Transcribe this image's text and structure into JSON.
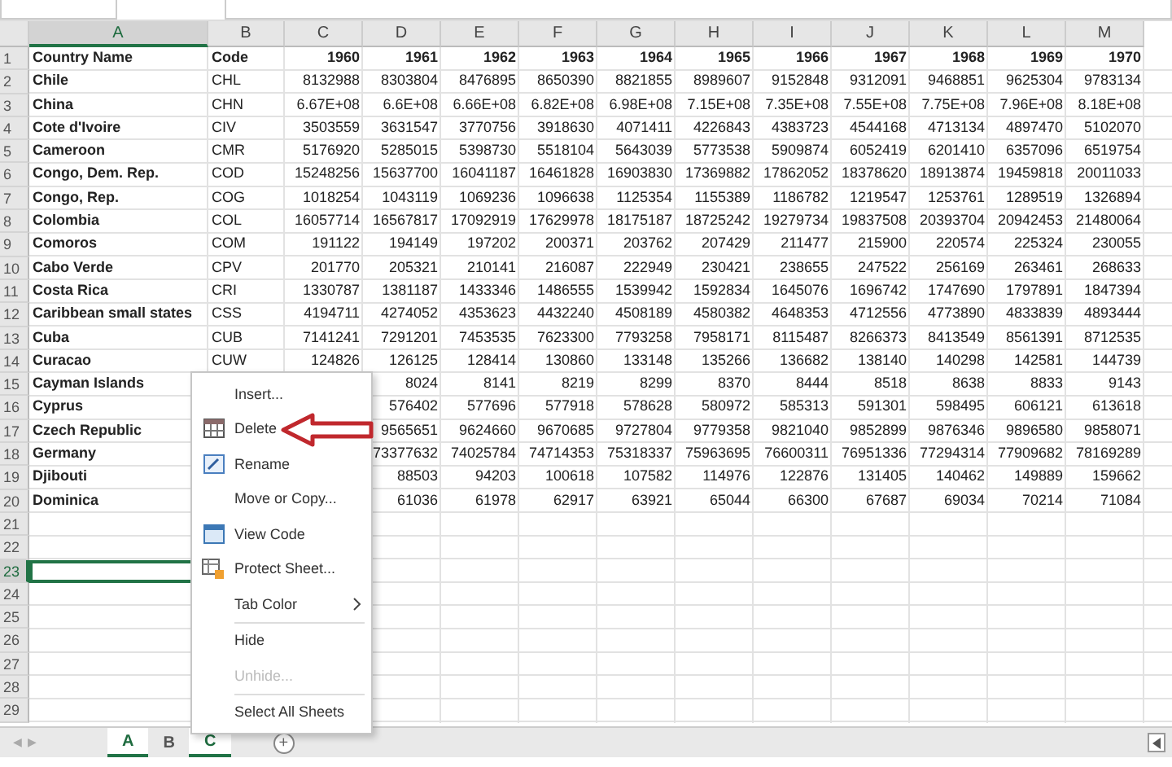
{
  "columns": [
    "A",
    "B",
    "C",
    "D",
    "E",
    "F",
    "G",
    "H",
    "I",
    "J",
    "K",
    "L",
    "M"
  ],
  "header_row": {
    "name": "Country Name",
    "code": "Code",
    "years": [
      "1960",
      "1961",
      "1962",
      "1963",
      "1964",
      "1965",
      "1966",
      "1967",
      "1968",
      "1969",
      "1970"
    ]
  },
  "rows": [
    {
      "name": "Chile",
      "code": "CHL",
      "values": [
        "8132988",
        "8303804",
        "8476895",
        "8650390",
        "8821855",
        "8989607",
        "9152848",
        "9312091",
        "9468851",
        "9625304",
        "9783134"
      ]
    },
    {
      "name": "China",
      "code": "CHN",
      "values": [
        "6.67E+08",
        "6.6E+08",
        "6.66E+08",
        "6.82E+08",
        "6.98E+08",
        "7.15E+08",
        "7.35E+08",
        "7.55E+08",
        "7.75E+08",
        "7.96E+08",
        "8.18E+08"
      ]
    },
    {
      "name": "Cote d'Ivoire",
      "code": "CIV",
      "values": [
        "3503559",
        "3631547",
        "3770756",
        "3918630",
        "4071411",
        "4226843",
        "4383723",
        "4544168",
        "4713134",
        "4897470",
        "5102070"
      ]
    },
    {
      "name": "Cameroon",
      "code": "CMR",
      "values": [
        "5176920",
        "5285015",
        "5398730",
        "5518104",
        "5643039",
        "5773538",
        "5909874",
        "6052419",
        "6201410",
        "6357096",
        "6519754"
      ]
    },
    {
      "name": "Congo, Dem. Rep.",
      "code": "COD",
      "values": [
        "15248256",
        "15637700",
        "16041187",
        "16461828",
        "16903830",
        "17369882",
        "17862052",
        "18378620",
        "18913874",
        "19459818",
        "20011033"
      ]
    },
    {
      "name": "Congo, Rep.",
      "code": "COG",
      "values": [
        "1018254",
        "1043119",
        "1069236",
        "1096638",
        "1125354",
        "1155389",
        "1186782",
        "1219547",
        "1253761",
        "1289519",
        "1326894"
      ]
    },
    {
      "name": "Colombia",
      "code": "COL",
      "values": [
        "16057714",
        "16567817",
        "17092919",
        "17629978",
        "18175187",
        "18725242",
        "19279734",
        "19837508",
        "20393704",
        "20942453",
        "21480064"
      ]
    },
    {
      "name": "Comoros",
      "code": "COM",
      "values": [
        "191122",
        "194149",
        "197202",
        "200371",
        "203762",
        "207429",
        "211477",
        "215900",
        "220574",
        "225324",
        "230055"
      ]
    },
    {
      "name": "Cabo Verde",
      "code": "CPV",
      "values": [
        "201770",
        "205321",
        "210141",
        "216087",
        "222949",
        "230421",
        "238655",
        "247522",
        "256169",
        "263461",
        "268633"
      ]
    },
    {
      "name": "Costa Rica",
      "code": "CRI",
      "values": [
        "1330787",
        "1381187",
        "1433346",
        "1486555",
        "1539942",
        "1592834",
        "1645076",
        "1696742",
        "1747690",
        "1797891",
        "1847394"
      ]
    },
    {
      "name": "Caribbean small states",
      "code": "CSS",
      "values": [
        "4194711",
        "4274052",
        "4353623",
        "4432240",
        "4508189",
        "4580382",
        "4648353",
        "4712556",
        "4773890",
        "4833839",
        "4893444"
      ]
    },
    {
      "name": "Cuba",
      "code": "CUB",
      "values": [
        "7141241",
        "7291201",
        "7453535",
        "7623300",
        "7793258",
        "7958171",
        "8115487",
        "8266373",
        "8413549",
        "8561391",
        "8712535"
      ]
    },
    {
      "name": "Curacao",
      "code": "CUW",
      "values": [
        "124826",
        "126125",
        "128414",
        "130860",
        "133148",
        "135266",
        "136682",
        "138140",
        "140298",
        "142581",
        "144739"
      ]
    },
    {
      "name": "Cayman Islands",
      "values": [
        "8024",
        "8141",
        "8219",
        "8299",
        "8370",
        "8444",
        "8518",
        "8638",
        "8833",
        "9143"
      ]
    },
    {
      "name": "Cyprus",
      "values": [
        "576402",
        "577696",
        "577918",
        "578628",
        "580972",
        "585313",
        "591301",
        "598495",
        "606121",
        "613618"
      ]
    },
    {
      "name": "Czech Republic",
      "values": [
        "9565651",
        "9624660",
        "9670685",
        "9727804",
        "9779358",
        "9821040",
        "9852899",
        "9876346",
        "9896580",
        "9858071"
      ]
    },
    {
      "name": "Germany",
      "values": [
        "73377632",
        "74025784",
        "74714353",
        "75318337",
        "75963695",
        "76600311",
        "76951336",
        "77294314",
        "77909682",
        "78169289"
      ]
    },
    {
      "name": "Djibouti",
      "values": [
        "88503",
        "94203",
        "100618",
        "107582",
        "114976",
        "122876",
        "131405",
        "140462",
        "149889",
        "159662"
      ]
    },
    {
      "name": "Dominica",
      "values": [
        "61036",
        "61978",
        "62917",
        "63921",
        "65044",
        "66300",
        "67687",
        "69034",
        "70214",
        "71084"
      ]
    }
  ],
  "row_numbers": [
    {
      "label": "1",
      "selected": false
    },
    {
      "label": "2",
      "selected": false
    },
    {
      "label": "3",
      "selected": false
    },
    {
      "label": "4",
      "selected": false
    },
    {
      "label": "5",
      "selected": false
    },
    {
      "label": "6",
      "selected": false
    },
    {
      "label": "7",
      "selected": false
    },
    {
      "label": "8",
      "selected": false
    },
    {
      "label": "9",
      "selected": false
    },
    {
      "label": "10",
      "selected": false
    },
    {
      "label": "11",
      "selected": false
    },
    {
      "label": "12",
      "selected": false
    },
    {
      "label": "13",
      "selected": false
    },
    {
      "label": "14",
      "selected": false
    },
    {
      "label": "15",
      "selected": false
    },
    {
      "label": "16",
      "selected": false
    },
    {
      "label": "17",
      "selected": false
    },
    {
      "label": "18",
      "selected": false
    },
    {
      "label": "19",
      "selected": false
    },
    {
      "label": "20",
      "selected": false
    },
    {
      "label": "21",
      "selected": false
    },
    {
      "label": "22",
      "selected": false
    },
    {
      "label": "23",
      "selected": true
    },
    {
      "label": "24",
      "selected": false
    },
    {
      "label": "25",
      "selected": false
    },
    {
      "label": "26",
      "selected": false
    },
    {
      "label": "27",
      "selected": false
    },
    {
      "label": "28",
      "selected": false
    },
    {
      "label": "29",
      "selected": false
    }
  ],
  "sheet_nav": [
    "◀",
    "▶"
  ],
  "context_menu": [
    {
      "label": "Insert...",
      "has_icon": false,
      "disabled": false,
      "submenu": false,
      "separator_before": false
    },
    {
      "label": "Delete",
      "has_icon": true,
      "disabled": false,
      "submenu": false,
      "separator_before": false
    },
    {
      "label": "Rename",
      "has_icon": true,
      "disabled": false,
      "submenu": false,
      "separator_before": false
    },
    {
      "label": "Move or Copy...",
      "has_icon": false,
      "disabled": false,
      "submenu": false,
      "separator_before": false
    },
    {
      "label": "View Code",
      "has_icon": true,
      "disabled": false,
      "submenu": false,
      "separator_before": false
    },
    {
      "label": "Protect Sheet...",
      "has_icon": true,
      "disabled": false,
      "submenu": false,
      "separator_before": false
    },
    {
      "label": "Tab Color",
      "has_icon": false,
      "disabled": false,
      "submenu": true,
      "separator_before": false
    },
    {
      "label": "Hide",
      "has_icon": false,
      "disabled": false,
      "submenu": false,
      "separator_before": true
    },
    {
      "label": "Unhide...",
      "has_icon": false,
      "disabled": true,
      "submenu": false,
      "separator_before": false
    },
    {
      "label": "Select All Sheets",
      "has_icon": false,
      "disabled": false,
      "submenu": false,
      "separator_before": true
    }
  ],
  "sheet_tabs": [
    {
      "label": "A",
      "selected": true
    },
    {
      "label": "B",
      "selected": false
    },
    {
      "label": "C",
      "selected": true
    }
  ],
  "add_sheet": "+"
}
